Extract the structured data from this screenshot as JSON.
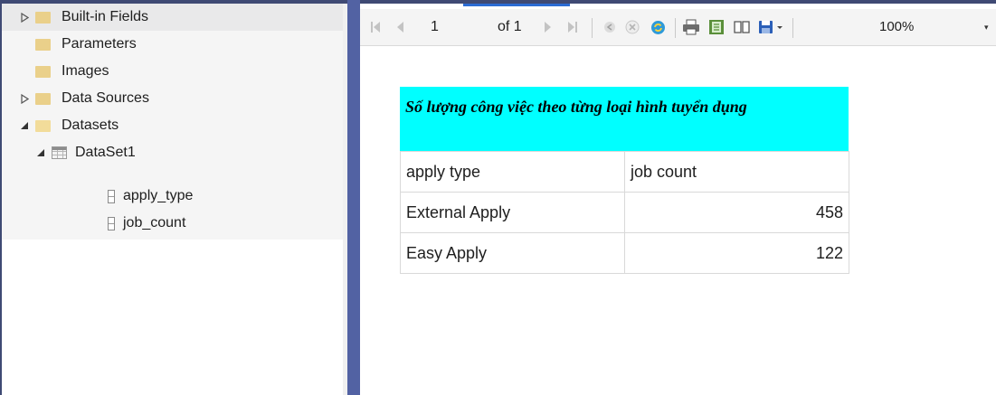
{
  "report_data_tree": {
    "items": [
      {
        "label": "Built-in Fields",
        "expander": "right",
        "icon": "folder-icon"
      },
      {
        "label": "Parameters",
        "expander": "",
        "icon": "folder-icon"
      },
      {
        "label": "Images",
        "expander": "",
        "icon": "folder-icon"
      },
      {
        "label": "Data Sources",
        "expander": "right",
        "icon": "folder-icon"
      },
      {
        "label": "Datasets",
        "expander": "down",
        "icon": "open-folder-icon"
      },
      {
        "label": "DataSet1",
        "expander": "down",
        "icon": "dataset-grid-icon"
      },
      {
        "label": "apply_type",
        "expander": "",
        "icon": "field-icon"
      },
      {
        "label": "job_count",
        "expander": "",
        "icon": "field-icon"
      }
    ]
  },
  "toolbar": {
    "page_value": "1",
    "of_label": "of 1",
    "zoom": "100%",
    "icons": [
      "first-page-icon",
      "previous-page-icon",
      "next-page-icon",
      "last-page-icon",
      "back-icon",
      "stop-icon",
      "refresh-icon",
      "print-icon",
      "print-layout-icon",
      "page-setup-icon",
      "export-icon",
      "zoom-dropdown-icon"
    ]
  },
  "report": {
    "title": "Số lượng công việc theo từng loại hình tuyển dụng",
    "title_bg": "#00ffff",
    "headers": [
      "apply type",
      "job count"
    ],
    "rows": [
      [
        "External Apply",
        "458"
      ],
      [
        "Easy Apply",
        "122"
      ]
    ]
  },
  "colors": {
    "divider": "#5262a3",
    "tab_accent": "#2b6cd4"
  }
}
